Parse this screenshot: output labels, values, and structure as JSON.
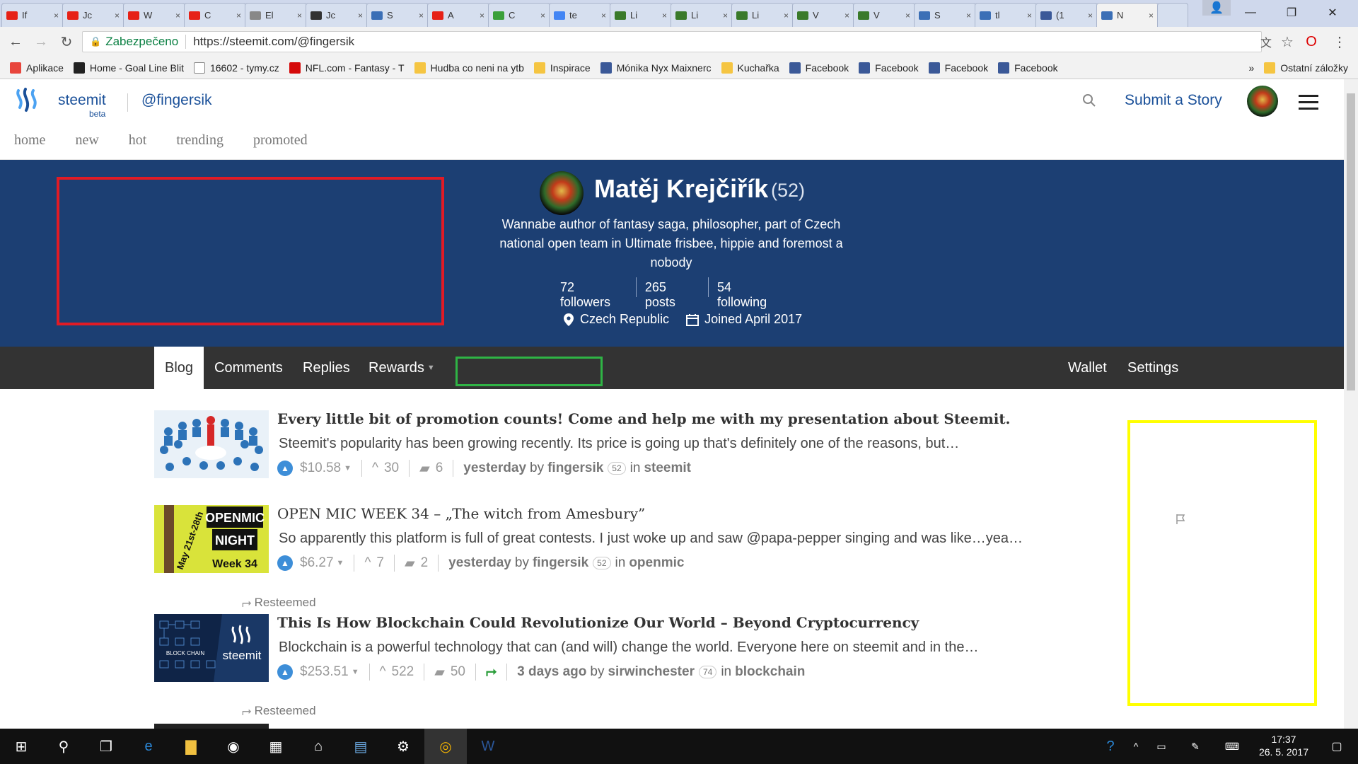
{
  "browser": {
    "tabs": [
      {
        "title": "If",
        "color": "#e62117"
      },
      {
        "title": "Jc",
        "color": "#e62117"
      },
      {
        "title": "W",
        "color": "#e62117"
      },
      {
        "title": "C",
        "color": "#e62117"
      },
      {
        "title": "El",
        "color": "#888888"
      },
      {
        "title": "Jc",
        "color": "#333333"
      },
      {
        "title": "S",
        "color": "#3b6fb6"
      },
      {
        "title": "A",
        "color": "#e62117"
      },
      {
        "title": "C",
        "color": "#3aa03a"
      },
      {
        "title": "te",
        "color": "#4285f4"
      },
      {
        "title": "Li",
        "color": "#3a7a2a"
      },
      {
        "title": "Li",
        "color": "#3a7a2a"
      },
      {
        "title": "Li",
        "color": "#3a7a2a"
      },
      {
        "title": "V",
        "color": "#3a7a2a"
      },
      {
        "title": "V",
        "color": "#3a7a2a"
      },
      {
        "title": "S",
        "color": "#3b6fb6"
      },
      {
        "title": "tl",
        "color": "#3b6fb6"
      },
      {
        "title": "(1",
        "color": "#3b5998"
      },
      {
        "title": "N",
        "color": "#3b6fb6"
      }
    ],
    "tab_close": "×",
    "secure_label": "Zabezpečeno",
    "url": "https://steemit.com/@fingersik"
  },
  "bookmarks": [
    {
      "label": "Aplikace",
      "color": "#e8453c"
    },
    {
      "label": "Home - Goal Line Blit",
      "color": "#222222"
    },
    {
      "label": "16602 - tymy.cz",
      "color": "#ffffff"
    },
    {
      "label": "NFL.com - Fantasy - T",
      "color": "#d50a0a"
    },
    {
      "label": "Hudba co neni na ytb",
      "color": "#f5c542"
    },
    {
      "label": "Inspirace",
      "color": "#f5c542"
    },
    {
      "label": "Mónika Nyx Maixnerc",
      "color": "#3b5998"
    },
    {
      "label": "Kuchařka",
      "color": "#f5c542"
    },
    {
      "label": "Facebook",
      "color": "#3b5998"
    },
    {
      "label": "Facebook",
      "color": "#3b5998"
    },
    {
      "label": "Facebook",
      "color": "#3b5998"
    },
    {
      "label": "Facebook",
      "color": "#3b5998"
    }
  ],
  "bookmarks_more": "»",
  "bookmarks_other": "Ostatní záložky",
  "site": {
    "brand": "steemit",
    "beta": "beta",
    "user_handle": "@fingersik",
    "submit_story": "Submit a Story",
    "subnav": [
      "home",
      "new",
      "hot",
      "trending",
      "promoted"
    ]
  },
  "profile": {
    "name": "Matěj Krejčiřík",
    "reputation": "(52)",
    "bio": "Wannabe author of fantasy saga, philosopher, part of Czech national open team in Ultimate frisbee, hippie and foremost a nobody",
    "followers": "72 followers",
    "posts": "265 posts",
    "following": "54 following",
    "location": "Czech Republic",
    "joined": "Joined April 2017"
  },
  "profile_tabs": {
    "blog": "Blog",
    "comments": "Comments",
    "replies": "Replies",
    "rewards": "Rewards",
    "wallet": "Wallet",
    "settings": "Settings"
  },
  "posts": [
    {
      "title": "Every little bit of promotion counts! Come and help me with my presentation about Steemit.",
      "excerpt": "Steemit's popularity has been growing recently. Its price is going up that's definitely one of the reasons, but…",
      "payout": "$10.58",
      "votes": "30",
      "comments": "6",
      "time": "yesterday",
      "author": "fingersik",
      "author_rep": "52",
      "category": "steemit"
    },
    {
      "title": "OPEN MIC WEEK 34 – „The witch from Amesbury”",
      "excerpt": "So apparently this platform is full of great contests. I just woke up and saw @papa-pepper singing and was like…yea…",
      "payout": "$6.27",
      "votes": "7",
      "comments": "2",
      "time": "yesterday",
      "author": "fingersik",
      "author_rep": "52",
      "category": "openmic",
      "thumb_text": [
        "OPENMIC",
        "NIGHT",
        "Week 34",
        "May 21st-28th"
      ]
    },
    {
      "resteemed": "Resteemed",
      "title": "This Is How Blockchain Could Revolutionize Our World – Beyond Cryptocurrency",
      "excerpt": "Blockchain is a powerful technology that can (and will) change the world. Everyone here on steemit and in the…",
      "payout": "$253.51",
      "votes": "522",
      "comments": "50",
      "time": "3 days ago",
      "author": "sirwinchester",
      "author_rep": "74",
      "category": "blockchain",
      "thumb_text": [
        "BLOCK CHAIN",
        "steemit"
      ]
    },
    {
      "resteemed": "Resteemed"
    }
  ],
  "labels": {
    "by": "by",
    "in": "in"
  },
  "taskbar": {
    "time": "17:37",
    "date": "26. 5. 2017"
  }
}
